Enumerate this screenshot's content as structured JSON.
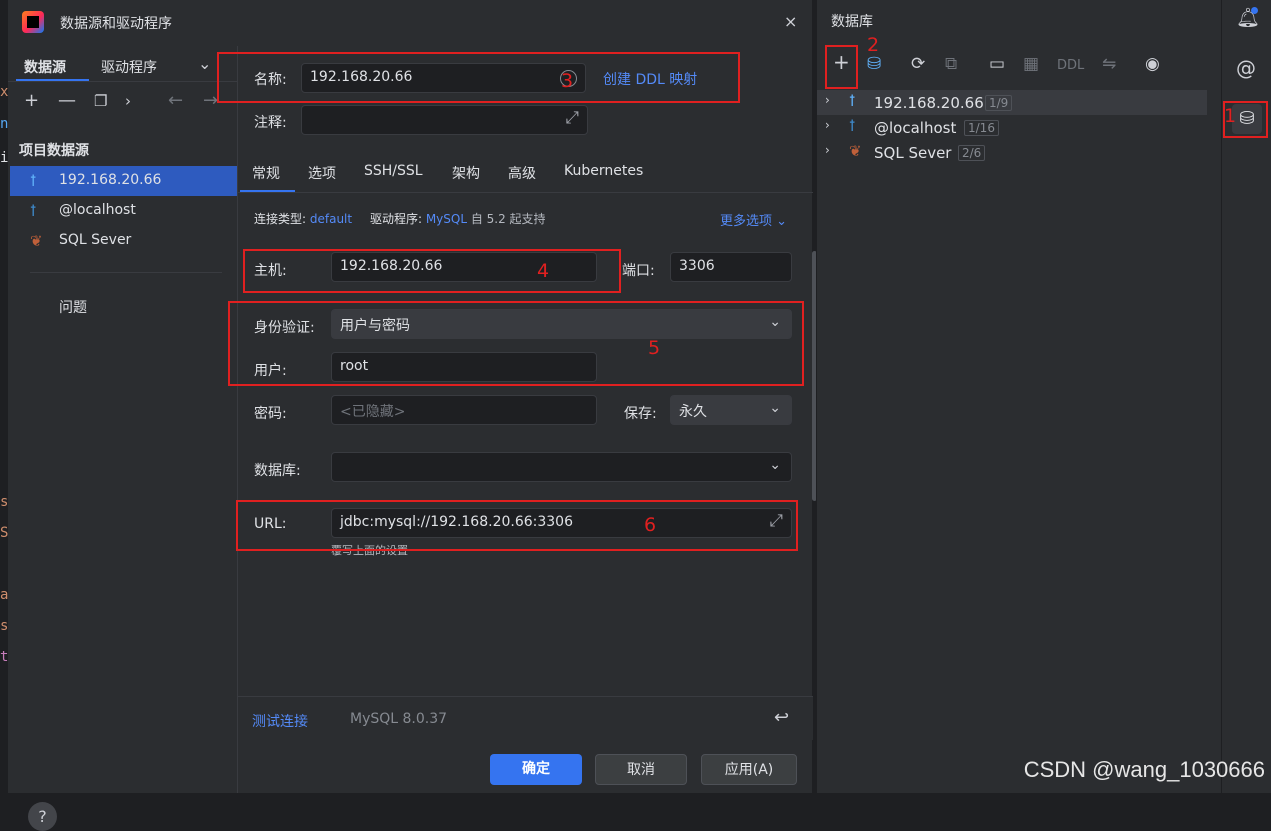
{
  "dialog": {
    "title": "数据源和驱动程序",
    "close_icon": "×",
    "left_tabs": [
      "数据源",
      "驱动程序"
    ],
    "section_title": "项目数据源",
    "sources": [
      {
        "label": "192.168.20.66",
        "icon": "mysql-icon"
      },
      {
        "label": "@localhost",
        "icon": "mysql-icon"
      },
      {
        "label": "SQL Sever",
        "icon": "sqlserver-icon"
      }
    ],
    "issues_label": "问题",
    "form": {
      "name_label": "名称:",
      "name_value": "192.168.20.66",
      "create_ddl_link": "创建 DDL 映射",
      "comment_label": "注释:",
      "tabs": [
        "常规",
        "选项",
        "SSH/SSL",
        "架构",
        "高级",
        "Kubernetes"
      ],
      "conn_type_label": "连接类型:",
      "conn_type_value": "default",
      "driver_label": "驱动程序:",
      "driver_value": "MySQL",
      "driver_suffix": "自 5.2 起支持",
      "more_options": "更多选项",
      "host_label": "主机:",
      "host_value": "192.168.20.66",
      "port_label": "端口:",
      "port_value": "3306",
      "auth_label": "身份验证:",
      "auth_value": "用户与密码",
      "user_label": "用户:",
      "user_value": "root",
      "password_label": "密码:",
      "password_placeholder": "<已隐藏>",
      "save_label": "保存:",
      "save_value": "永久",
      "database_label": "数据库:",
      "url_label": "URL:",
      "url_value": "jdbc:mysql://192.168.20.66:3306",
      "url_hint": "覆写上面的设置",
      "test_connection": "测试连接",
      "server_version": "MySQL 8.0.37",
      "ok_button": "确定",
      "cancel_button": "取消",
      "apply_button": "应用(A)"
    }
  },
  "db_panel": {
    "title": "数据库",
    "toolbar_ddl": "DDL",
    "tree": [
      {
        "label": "192.168.20.66",
        "count": "1/9"
      },
      {
        "label": "@localhost",
        "count": "1/16"
      },
      {
        "label": "SQL Sever",
        "count": "2/6"
      }
    ]
  },
  "annotations": [
    "1",
    "2",
    "3",
    "4",
    "5",
    "6"
  ],
  "watermark": "CSDN @wang_1030666",
  "gutter_chars": [
    "x",
    "n",
    "i",
    "a",
    "s",
    "S",
    "a",
    "s",
    "t"
  ],
  "colors": {
    "accent": "#3574f0",
    "annotation": "#e02020",
    "link": "#548af7"
  }
}
